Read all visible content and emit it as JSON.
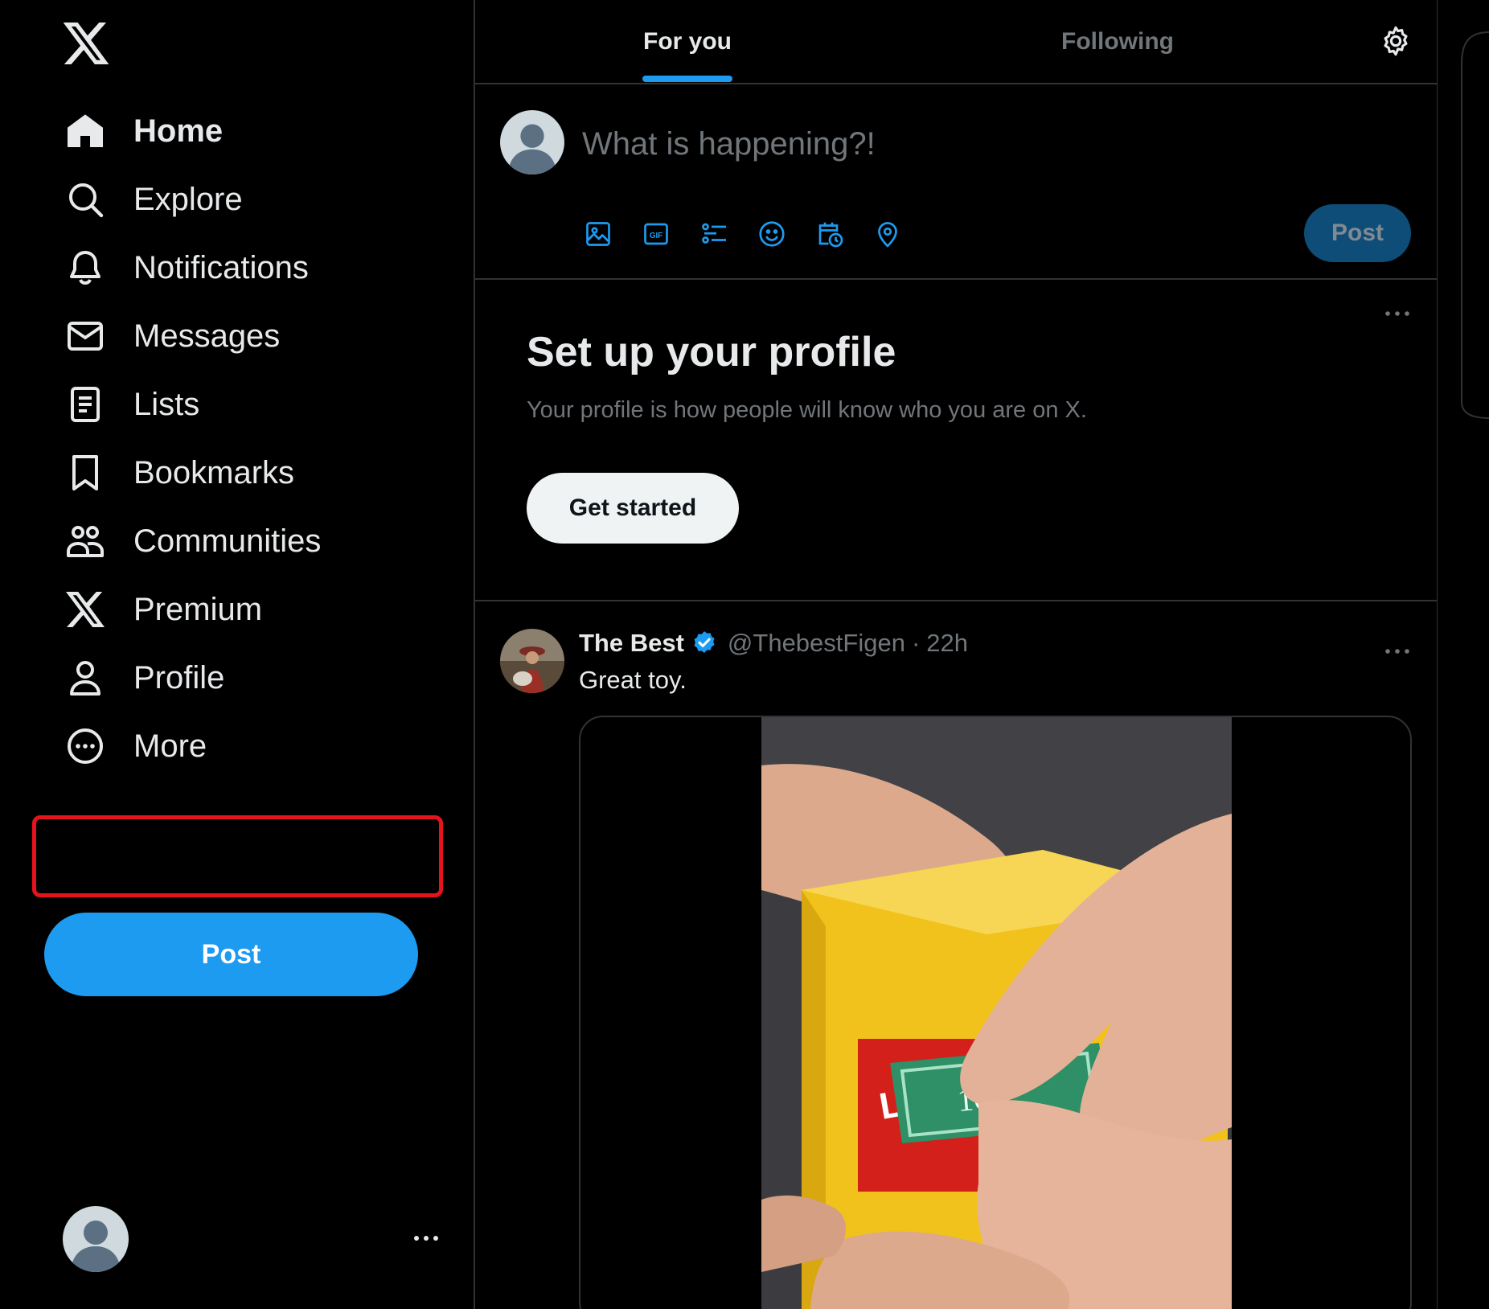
{
  "sidebar": {
    "logo": "x-logo-icon",
    "items": [
      {
        "label": "Home",
        "icon": "home-icon",
        "active": true
      },
      {
        "label": "Explore",
        "icon": "search-icon"
      },
      {
        "label": "Notifications",
        "icon": "bell-icon"
      },
      {
        "label": "Messages",
        "icon": "envelope-icon"
      },
      {
        "label": "Lists",
        "icon": "list-icon"
      },
      {
        "label": "Bookmarks",
        "icon": "bookmark-icon"
      },
      {
        "label": "Communities",
        "icon": "communities-icon"
      },
      {
        "label": "Premium",
        "icon": "x-logo-icon"
      },
      {
        "label": "Profile",
        "icon": "person-icon"
      },
      {
        "label": "More",
        "icon": "more-circle-icon",
        "highlighted": true
      }
    ],
    "post_label": "Post"
  },
  "tabs": [
    {
      "label": "For you",
      "active": true
    },
    {
      "label": "Following"
    }
  ],
  "composer": {
    "placeholder": "What is happening?!",
    "tools": [
      "image-icon",
      "gif-icon",
      "poll-icon",
      "emoji-icon",
      "schedule-icon",
      "location-icon"
    ],
    "post_label": "Post"
  },
  "profile_card": {
    "title": "Set up your profile",
    "subtitle": "Your profile is how people will know who you are on X.",
    "button_label": "Get started"
  },
  "tweet": {
    "name": "The Best",
    "handle": "@ThebestFigen",
    "separator": "·",
    "time": "22h",
    "text": "Great toy."
  },
  "colors": {
    "background": "#000000",
    "accent": "#1d9bf0",
    "text_primary": "#e7e9ea",
    "text_secondary": "#71767b",
    "highlight": "#e5141b"
  }
}
